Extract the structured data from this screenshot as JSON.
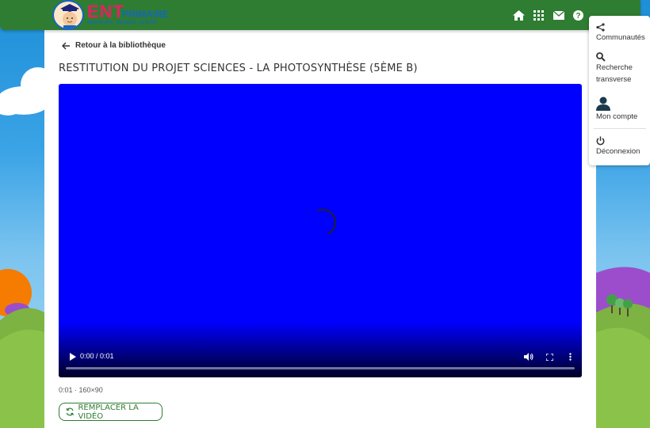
{
  "app": {
    "logo_ent": "ENT",
    "logo_primaire": "PRIMAIRE",
    "logo_tagline": "Apprendre, partager, grandir"
  },
  "topbar": {
    "icons": [
      "home-icon",
      "apps-grid-icon",
      "mail-icon",
      "help-icon"
    ]
  },
  "side_menu": {
    "items": [
      {
        "label": "Communautés",
        "icon": "share-icon"
      },
      {
        "label": "Recherche transverse",
        "icon": "search-icon"
      },
      {
        "label": "Mon compte",
        "icon": "user-icon"
      },
      {
        "label": "Déconnexion",
        "icon": "power-icon"
      }
    ]
  },
  "page": {
    "back_label": "Retour à la bibliothèque",
    "title": "Restitution du projet Sciences - La photosynthèse (5ème B)"
  },
  "video": {
    "time_display": "0:00 / 0:01",
    "progress_fraction": 0,
    "meta": "0:01 · 160×90",
    "background_color": "#0000ff"
  },
  "actions": {
    "replace_label": "Remplacer la vidéo"
  },
  "colors": {
    "brand_green": "#2e7d32",
    "video_blue": "#0000ff"
  }
}
